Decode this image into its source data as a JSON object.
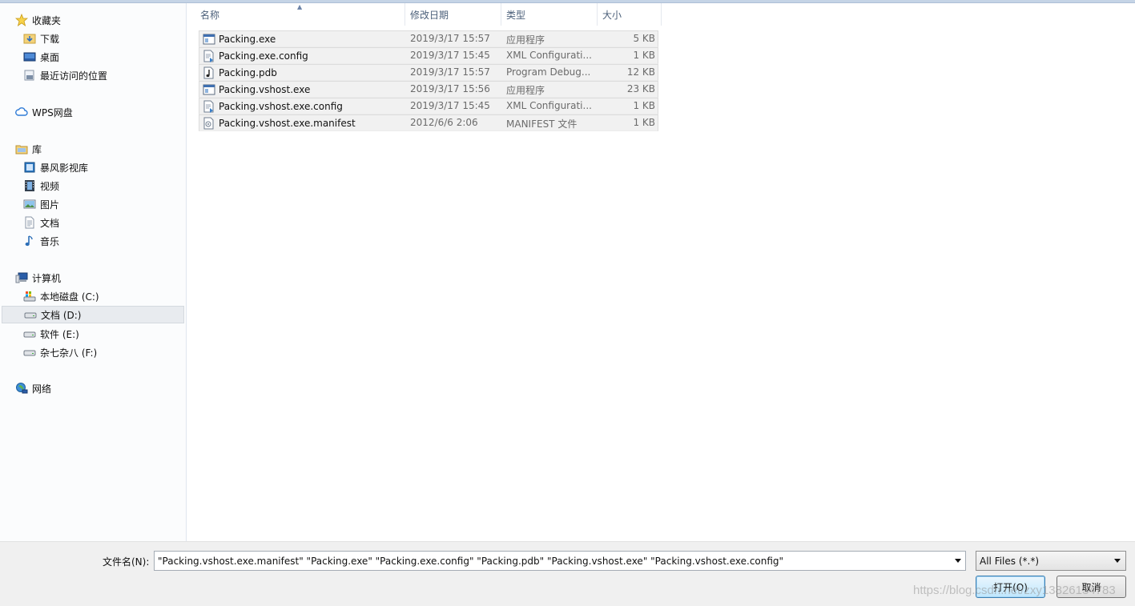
{
  "sidebar": {
    "favorites": {
      "label": "收藏夹",
      "items": [
        {
          "label": "下载",
          "icon": "downloads-folder-icon"
        },
        {
          "label": "桌面",
          "icon": "desktop-icon"
        },
        {
          "label": "最近访问的位置",
          "icon": "recent-places-icon"
        }
      ]
    },
    "wps": {
      "label": "WPS网盘",
      "icon": "cloud-icon"
    },
    "libraries": {
      "label": "库",
      "items": [
        {
          "label": "暴风影视库",
          "icon": "media-library-icon"
        },
        {
          "label": "视频",
          "icon": "video-icon"
        },
        {
          "label": "图片",
          "icon": "picture-icon"
        },
        {
          "label": "文档",
          "icon": "document-icon"
        },
        {
          "label": "音乐",
          "icon": "music-icon"
        }
      ]
    },
    "computer": {
      "label": "计算机",
      "items": [
        {
          "label": "本地磁盘 (C:)",
          "icon": "system-drive-icon"
        },
        {
          "label": "文档 (D:)",
          "icon": "drive-icon",
          "selected": true
        },
        {
          "label": "软件 (E:)",
          "icon": "drive-icon"
        },
        {
          "label": "杂七杂八 (F:)",
          "icon": "drive-icon"
        }
      ]
    },
    "network": {
      "label": "网络",
      "icon": "network-icon"
    }
  },
  "columns": {
    "name": "名称",
    "date": "修改日期",
    "type": "类型",
    "size": "大小"
  },
  "files": [
    {
      "name": "Packing.exe",
      "date": "2019/3/17 15:57",
      "type": "应用程序",
      "size": "5 KB",
      "icon": "exe-icon"
    },
    {
      "name": "Packing.exe.config",
      "date": "2019/3/17 15:45",
      "type": "XML Configurati...",
      "size": "1 KB",
      "icon": "config-file-icon"
    },
    {
      "name": "Packing.pdb",
      "date": "2019/3/17 15:57",
      "type": "Program Debug...",
      "size": "12 KB",
      "icon": "pdb-file-icon"
    },
    {
      "name": "Packing.vshost.exe",
      "date": "2019/3/17 15:56",
      "type": "应用程序",
      "size": "23 KB",
      "icon": "exe-icon"
    },
    {
      "name": "Packing.vshost.exe.config",
      "date": "2019/3/17 15:45",
      "type": "XML Configurati...",
      "size": "1 KB",
      "icon": "config-file-icon"
    },
    {
      "name": "Packing.vshost.exe.manifest",
      "date": "2012/6/6 2:06",
      "type": "MANIFEST 文件",
      "size": "1 KB",
      "icon": "manifest-file-icon"
    }
  ],
  "bottom": {
    "filename_label": "文件名(N):",
    "filename_value": "\"Packing.vshost.exe.manifest\" \"Packing.exe\" \"Packing.exe.config\" \"Packing.pdb\" \"Packing.vshost.exe\" \"Packing.vshost.exe.config\"",
    "filter_value": "All Files (*.*)",
    "open_label": "打开(O)",
    "cancel_label": "取消"
  },
  "watermark": "https://blog.csdn.net/zxy13826134783",
  "colors": {
    "accent": "#3c7fb1",
    "selection": "#e8ebef",
    "row_bg": "#f1f1f1"
  }
}
